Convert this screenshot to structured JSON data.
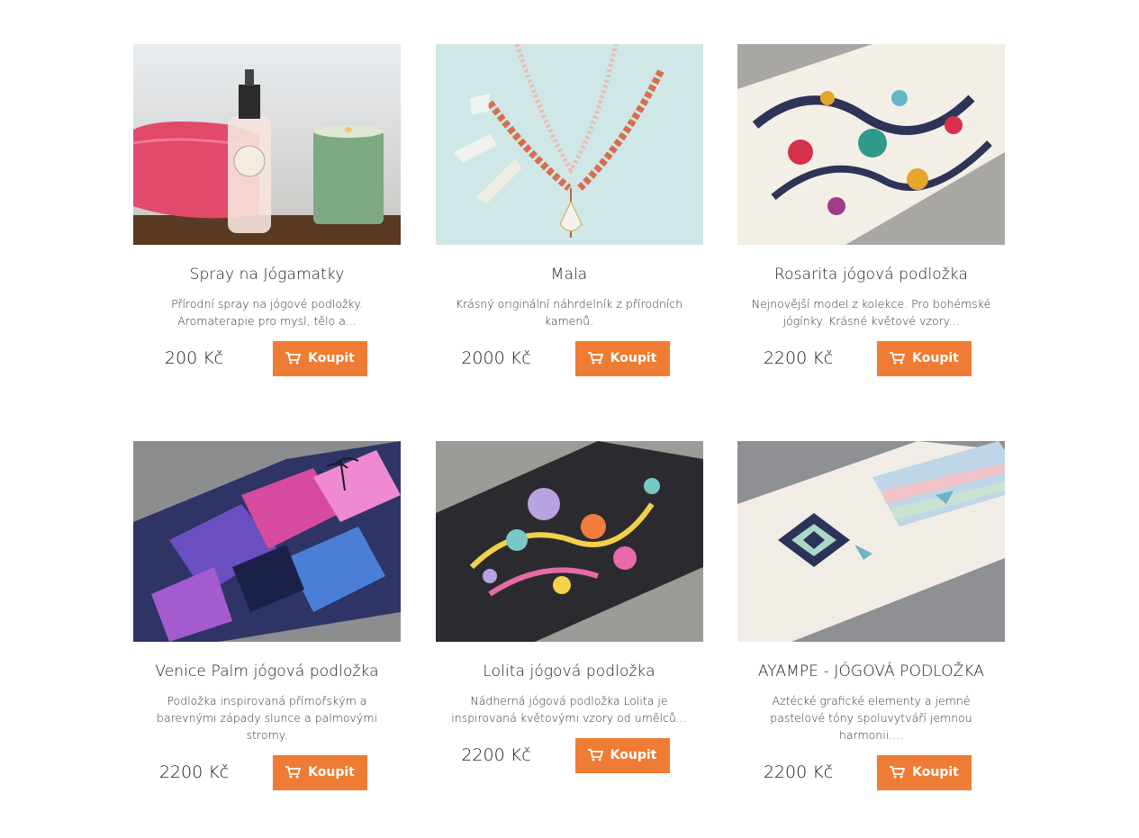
{
  "products": [
    {
      "image": "spray-bottle-candle-photo",
      "title": "Spray na Jógamatky",
      "description": "Přírodní spray na jógové podložky. Aromaterapie pro mysl, tělo a...",
      "price": "200 Kč",
      "button_label": "Koupit"
    },
    {
      "image": "mala-necklace-photo",
      "title": "Mala",
      "description": "Krásný originální náhrdelník z přírodních kamenů.",
      "price": "2000 Kč",
      "button_label": "Koupit"
    },
    {
      "image": "rosarita-mat-photo",
      "title": "Rosarita jógová podložka",
      "description": "Nejnovější model z kolekce. Pro bohémské jógínky. Krásné květové vzory...",
      "price": "2200 Kč",
      "button_label": "Koupit"
    },
    {
      "image": "venice-palm-mat-photo",
      "title": "Venice Palm jógová podložka",
      "description": "Podložka inspirovaná přímořským a barevnými západy slunce a palmovými stromy.",
      "price": "2200 Kč",
      "button_label": "Koupit"
    },
    {
      "image": "lolita-mat-photo",
      "title": "Lolita jógová podložka",
      "description": "Nádherná jógová podložka Lolita je inspirovaná květovými vzory od umělců...",
      "price": "2200 Kč",
      "button_label": "Koupit"
    },
    {
      "image": "ayampe-mat-photo",
      "title": "AYAMPE - JÓGOVÁ PODLOŽKA",
      "description": "Aztécké grafické elementy a jemné pastelové tóny spoluvytváří jemnou harmonii....",
      "price": "2200 Kč",
      "button_label": "Koupit"
    }
  ],
  "colors": {
    "button": "#ef7c34",
    "button_text": "#ffffff",
    "text": "#1d1d1d"
  },
  "icons": {
    "button_icon": "cart-icon"
  }
}
